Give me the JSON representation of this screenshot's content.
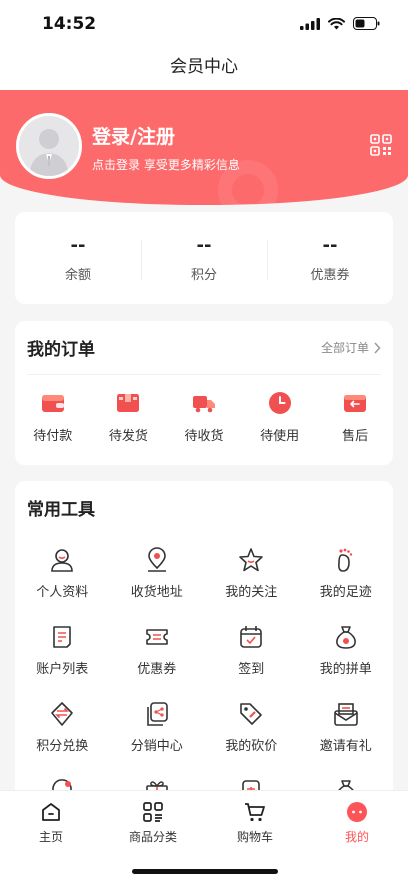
{
  "status_bar": {
    "time": "14:52"
  },
  "nav": {
    "title": "会员中心"
  },
  "profile": {
    "login_title": "登录/注册",
    "login_subtitle": "点击登录 享受更多精彩信息"
  },
  "assets": [
    {
      "value": "--",
      "label": "余额"
    },
    {
      "value": "--",
      "label": "积分"
    },
    {
      "value": "--",
      "label": "优惠券"
    }
  ],
  "orders": {
    "title": "我的订单",
    "more": "全部订单",
    "items": [
      {
        "label": "待付款",
        "icon": "wallet-icon"
      },
      {
        "label": "待发货",
        "icon": "package-icon"
      },
      {
        "label": "待收货",
        "icon": "truck-icon"
      },
      {
        "label": "待使用",
        "icon": "clock-icon"
      },
      {
        "label": "售后",
        "icon": "return-icon"
      }
    ]
  },
  "tools": {
    "title": "常用工具",
    "items": [
      {
        "label": "个人资料",
        "icon": "person-icon"
      },
      {
        "label": "收货地址",
        "icon": "location-pin-icon"
      },
      {
        "label": "我的关注",
        "icon": "star-icon"
      },
      {
        "label": "我的足迹",
        "icon": "footprint-icon"
      },
      {
        "label": "账户列表",
        "icon": "document-icon"
      },
      {
        "label": "优惠券",
        "icon": "coupon-icon"
      },
      {
        "label": "签到",
        "icon": "calendar-check-icon"
      },
      {
        "label": "我的拼单",
        "icon": "money-bag-icon"
      },
      {
        "label": "积分兑换",
        "icon": "exchange-icon"
      },
      {
        "label": "分销中心",
        "icon": "share-icon"
      },
      {
        "label": "我的砍价",
        "icon": "price-tag-icon"
      },
      {
        "label": "邀请有礼",
        "icon": "envelope-icon"
      },
      {
        "label": "",
        "icon": "customer-service-icon"
      },
      {
        "label": "",
        "icon": "gift-icon"
      },
      {
        "label": "",
        "icon": "voucher-icon"
      },
      {
        "label": "",
        "icon": "money-bag-icon"
      }
    ]
  },
  "tabs": [
    {
      "label": "主页",
      "icon": "home-icon"
    },
    {
      "label": "商品分类",
      "icon": "category-icon"
    },
    {
      "label": "购物车",
      "icon": "cart-icon"
    },
    {
      "label": "我的",
      "icon": "profile-icon"
    }
  ],
  "colors": {
    "accent": "#fd6a6b",
    "active_tab": "#fd5557"
  }
}
